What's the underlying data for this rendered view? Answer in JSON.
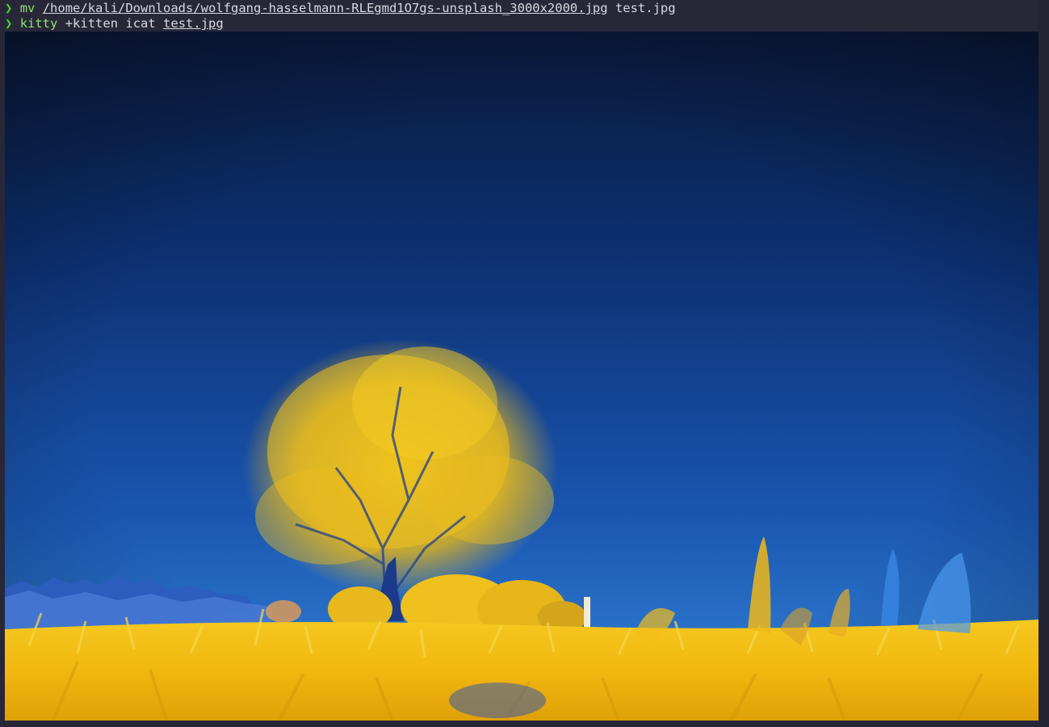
{
  "terminal": {
    "prompt_symbol": "❯",
    "line1": {
      "command": "mv",
      "source_path": "/home/kali/Downloads/wolfgang-hasselmann-RLEgmd1O7gs-unsplash_3000x2000.jpg",
      "destination": "test.jpg"
    },
    "line2": {
      "command": "kitty",
      "subcommand": "+kitten icat",
      "file": "test.jpg"
    }
  },
  "colors": {
    "background": "#282738",
    "prompt": "#4cd137",
    "command": "#8fe36f",
    "text": "#d8d8e2",
    "sky_top": "#0a1e45",
    "sky_bottom": "#2f7fd6",
    "foliage": "#f2c418"
  },
  "image": {
    "description_icon": "photo-preview"
  }
}
